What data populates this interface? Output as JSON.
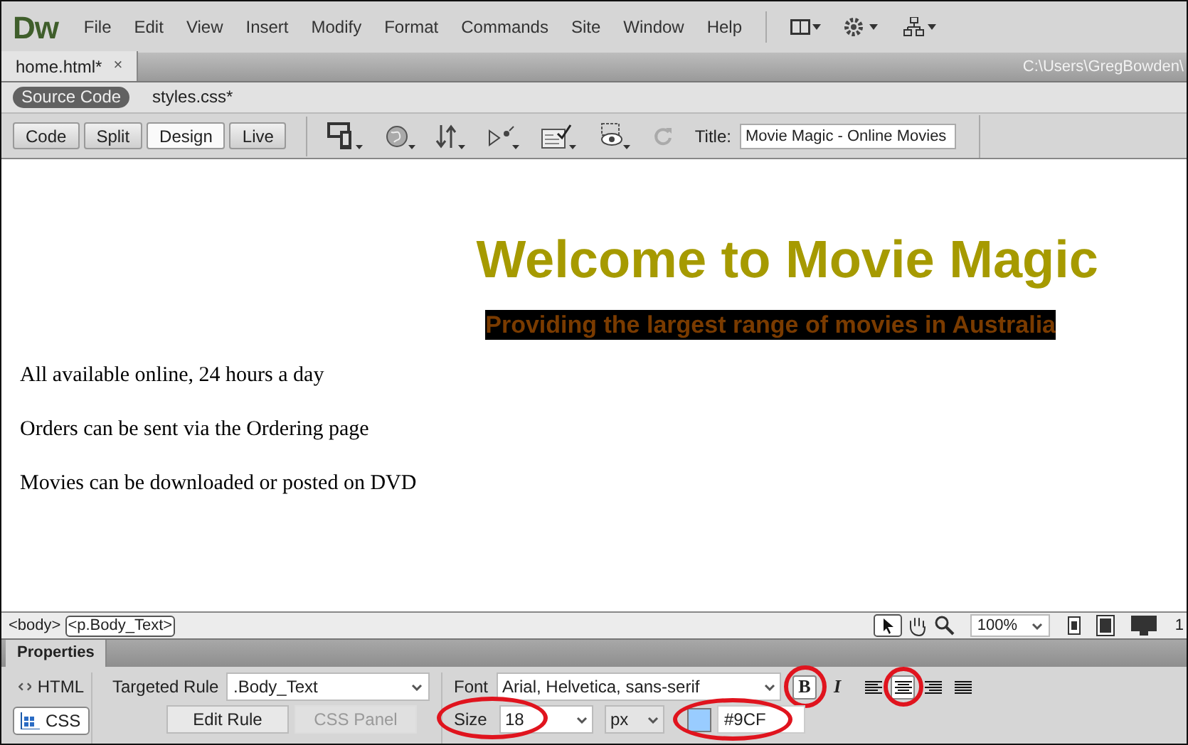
{
  "app": {
    "logo": "Dw"
  },
  "menu": [
    "File",
    "Edit",
    "View",
    "Insert",
    "Modify",
    "Format",
    "Commands",
    "Site",
    "Window",
    "Help"
  ],
  "document_tabs": [
    {
      "label": "home.html*",
      "close": "×",
      "selected": true
    }
  ],
  "path": "C:\\Users\\GregBowden\\",
  "related_files": [
    {
      "label": "Source Code",
      "selected": true
    },
    {
      "label": "styles.css*",
      "selected": false
    }
  ],
  "view_buttons": [
    {
      "label": "Code",
      "selected": false
    },
    {
      "label": "Split",
      "selected": false
    },
    {
      "label": "Design",
      "selected": true
    },
    {
      "label": "Live",
      "selected": false
    }
  ],
  "title_field": {
    "label": "Title:",
    "value": "Movie Magic - Online Movies"
  },
  "design_view": {
    "heading": "Welcome to Movie Magic",
    "subheading": "Providing the largest range of movies in Australia",
    "paragraphs": [
      "All available online, 24 hours a day",
      "Orders can be sent via the Ordering page",
      "Movies can be downloaded or posted on DVD"
    ]
  },
  "tag_selector": [
    {
      "label": "<body>",
      "selected": false
    },
    {
      "label": "<p.Body_Text>",
      "selected": true
    }
  ],
  "zoom": "100%",
  "status_cut": "1",
  "properties": {
    "tab": "Properties",
    "modes": [
      {
        "label": "HTML",
        "selected": false
      },
      {
        "label": "CSS",
        "selected": true
      }
    ],
    "targeted_rule_label": "Targeted Rule",
    "targeted_rule": ".Body_Text",
    "edit_rule": "Edit Rule",
    "css_panel": {
      "label": "CSS Panel",
      "disabled": true
    },
    "font_label": "Font",
    "font": "Arial, Helvetica, sans-serif",
    "size_label": "Size",
    "size": {
      "value": "18",
      "highlighted": true
    },
    "unit": "px",
    "color": {
      "color": "#99ccff",
      "value": "#9CF",
      "highlighted": true
    },
    "bold": {
      "label": "B",
      "selected": true,
      "highlighted": true
    },
    "italic": {
      "label": "I",
      "selected": false
    },
    "align": [
      {
        "kind": "left",
        "selected": false,
        "highlighted": false
      },
      {
        "kind": "center",
        "selected": true,
        "highlighted": true
      },
      {
        "kind": "right",
        "selected": false,
        "highlighted": false
      },
      {
        "kind": "justify",
        "selected": false,
        "highlighted": false
      }
    ]
  }
}
